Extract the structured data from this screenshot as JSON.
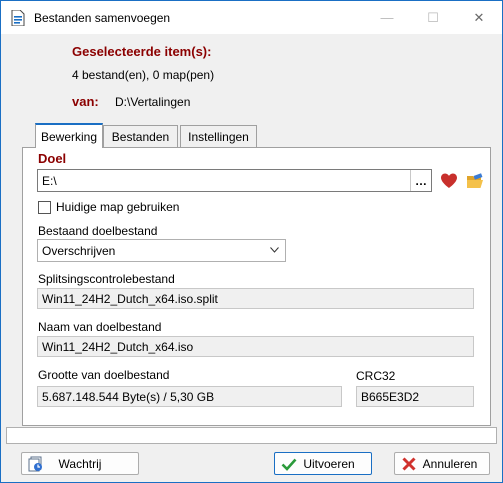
{
  "window": {
    "title": "Bestanden samenvoegen",
    "minimize_glyph": "—",
    "maximize_glyph": "☐",
    "close_glyph": "✕"
  },
  "header": {
    "selected_label": "Geselecteerde item(s):",
    "selected_value": "4 bestand(en), 0 map(pen)",
    "from_label": "van:",
    "from_value": "D:\\Vertalingen"
  },
  "tabs": [
    {
      "label": "Bewerking",
      "active": true
    },
    {
      "label": "Bestanden",
      "active": false
    },
    {
      "label": "Instellingen",
      "active": false
    }
  ],
  "panel": {
    "target_title": "Doel",
    "target_path": "E:\\",
    "browse_label": "…",
    "use_current_folder_label": "Huidige map gebruiken",
    "use_current_folder_checked": false,
    "existing_target_label": "Bestaand doelbestand",
    "existing_target_value": "Overschrijven",
    "split_control_label": "Splitsingscontrolebestand",
    "split_control_value": "Win11_24H2_Dutch_x64.iso.split",
    "target_name_label": "Naam van doelbestand",
    "target_name_value": "Win11_24H2_Dutch_x64.iso",
    "target_size_label": "Grootte van doelbestand",
    "target_size_value": "5.687.148.544 Byte(s) / 5,30 GB",
    "crc_label": "CRC32",
    "crc_value": "B665E3D2"
  },
  "buttons": {
    "queue_label": "Wachtrij",
    "run_label": "Uitvoeren",
    "cancel_label": "Annuleren"
  },
  "colors": {
    "accent": "#1a6fc4",
    "label_dark_red": "#8b0000",
    "heart": "#c8302c",
    "ok_green": "#2a9a3a",
    "cancel_red": "#d0312d"
  },
  "icons": {
    "app": "file-merge-icon",
    "favorite": "heart-icon",
    "folder": "folder-open-icon",
    "queue": "queue-icon",
    "run": "check-icon",
    "cancel": "x-icon"
  }
}
